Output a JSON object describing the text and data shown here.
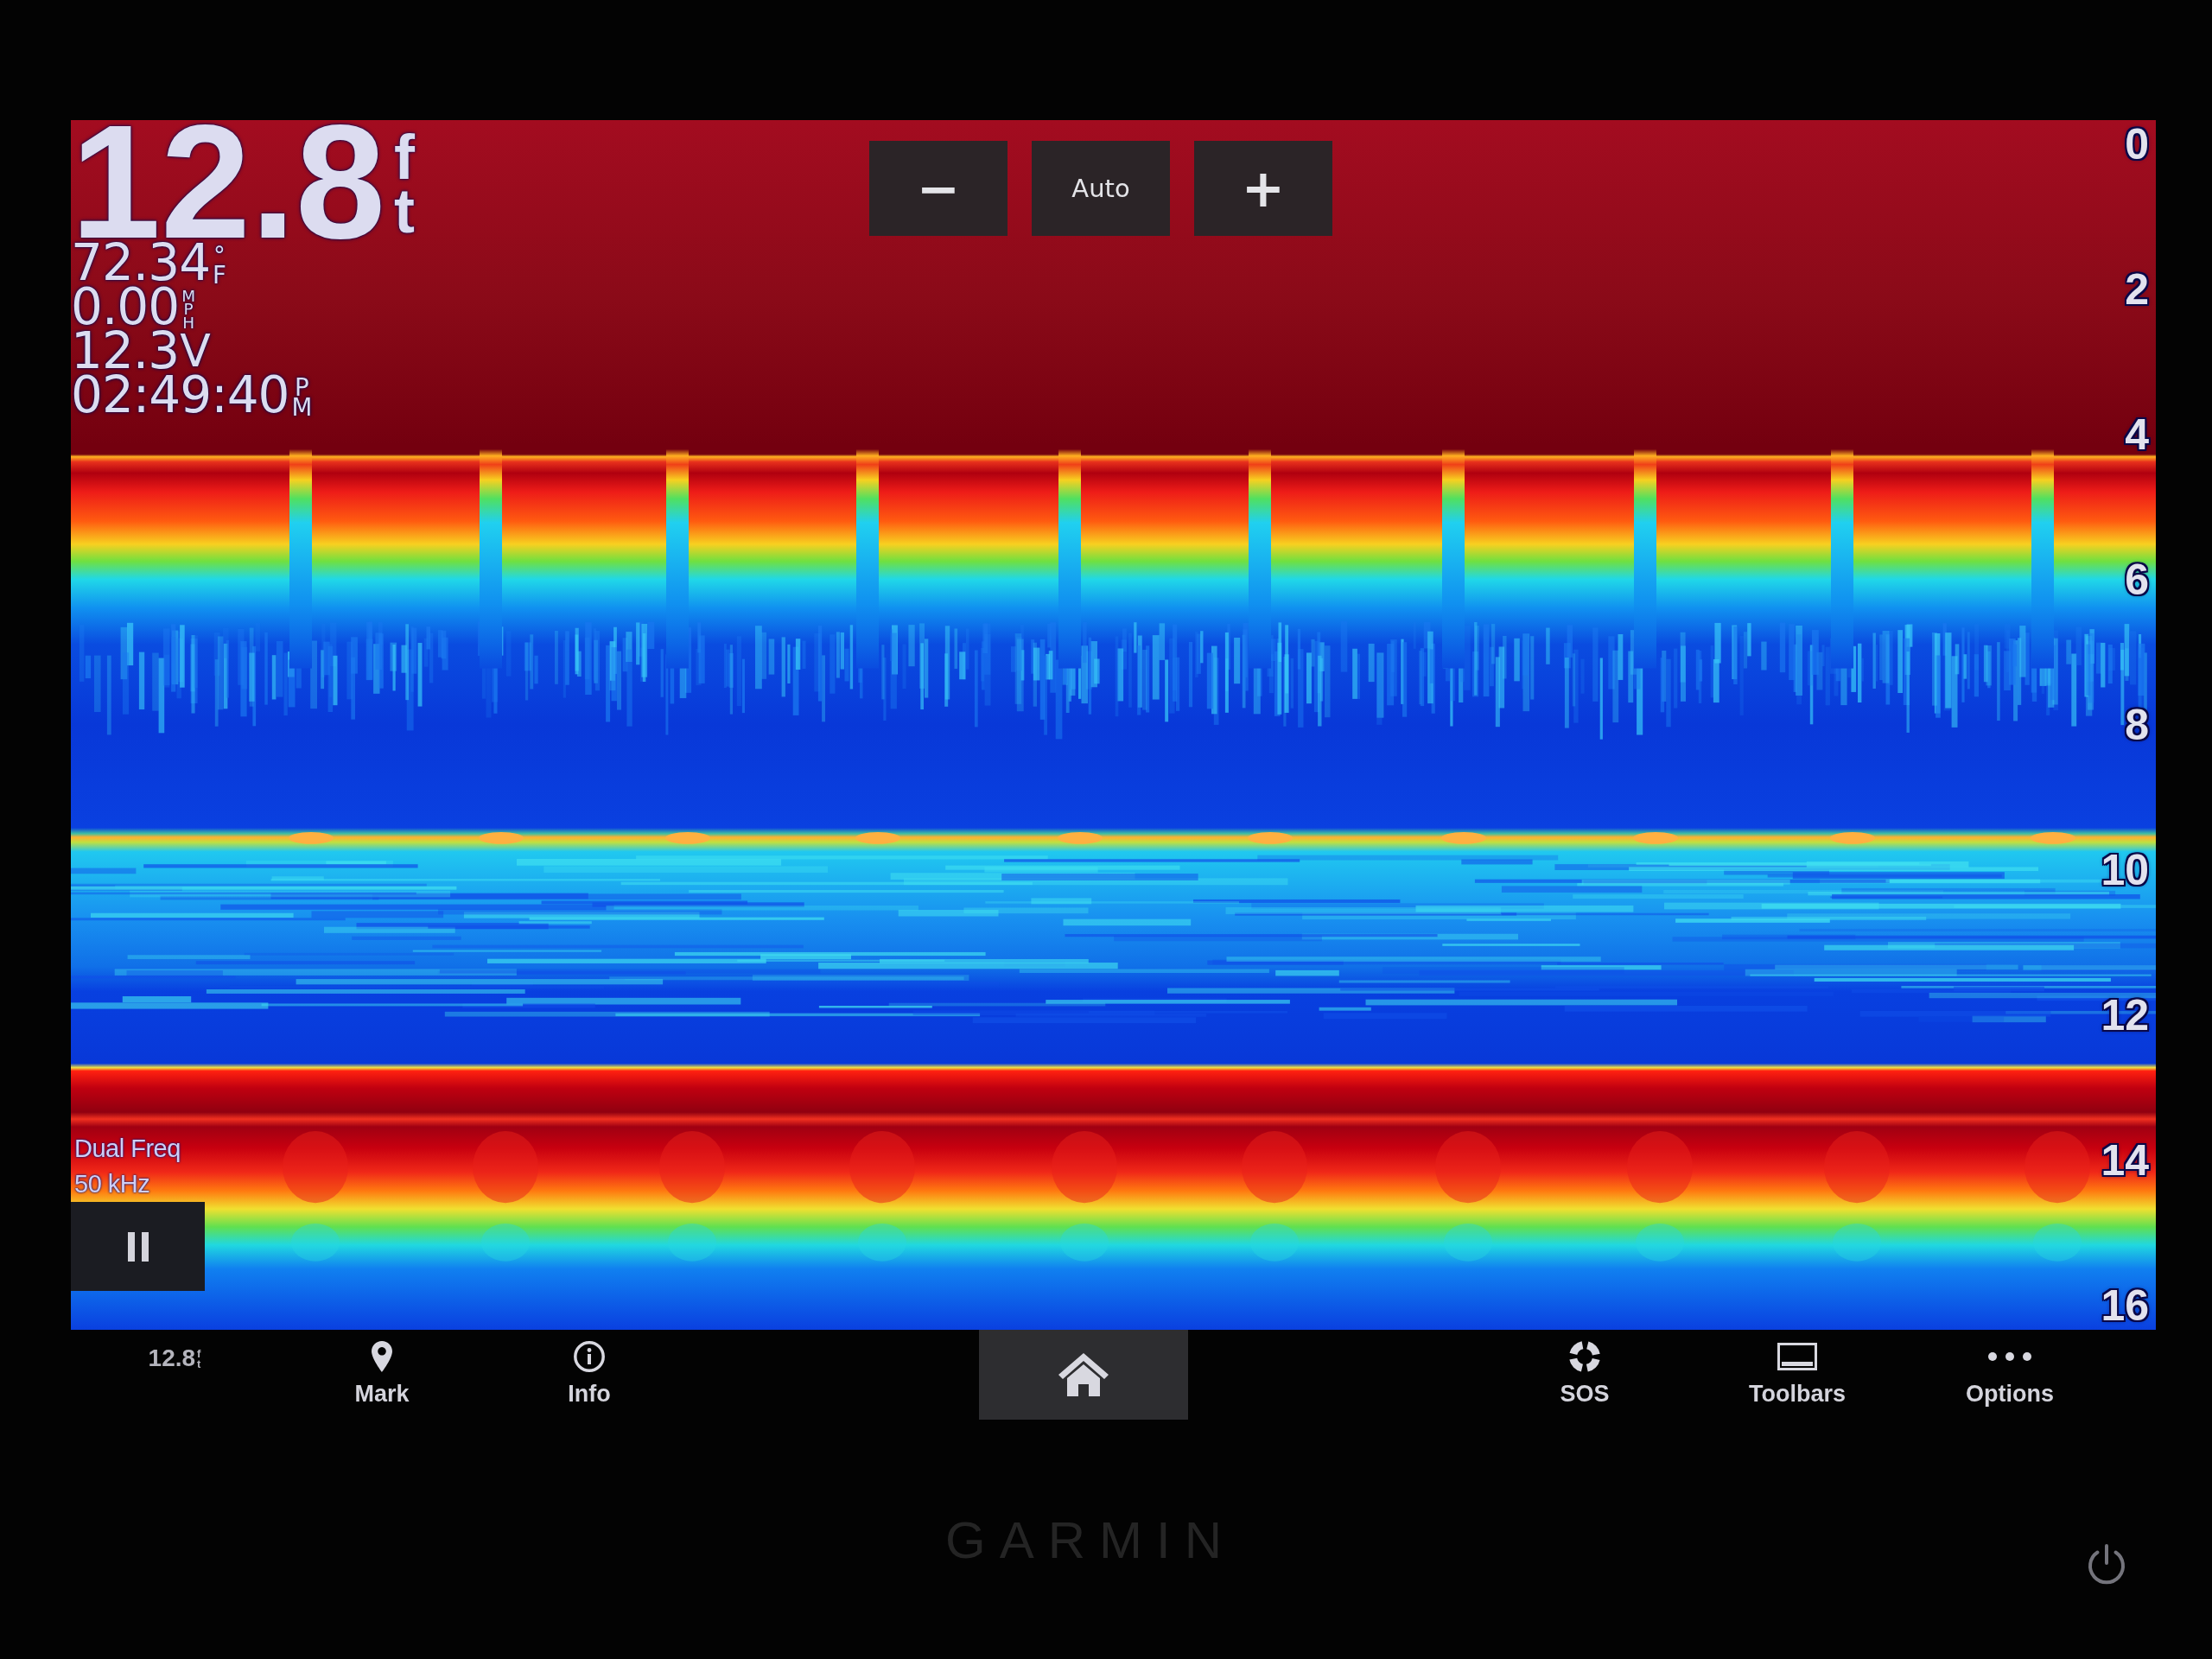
{
  "depth": {
    "value": "12.8",
    "unit": "ft"
  },
  "data_fields": [
    {
      "value": "72.34",
      "unit": "°F",
      "kind": "stacked"
    },
    {
      "value": "0.00",
      "unit": "MPH",
      "kind": "stacked"
    },
    {
      "value": "12.3",
      "unit": "V",
      "kind": "inline"
    },
    {
      "value": "02:49:40",
      "unit": "PM",
      "kind": "stacked"
    }
  ],
  "range_buttons": [
    {
      "label": "−",
      "kind": "symbol"
    },
    {
      "label": "Auto",
      "kind": "text"
    },
    {
      "label": "+",
      "kind": "symbol"
    }
  ],
  "depth_scale": [
    "0",
    "2",
    "4",
    "6",
    "8",
    "10",
    "12",
    "14",
    "16"
  ],
  "frequency": [
    "Dual Freq",
    "50 kHz"
  ],
  "toolbar": {
    "readout": {
      "value": "12.8",
      "unit": "ft"
    },
    "left_buttons": [
      {
        "label": "Mark"
      },
      {
        "label": "Info"
      }
    ],
    "right_buttons": [
      {
        "label": "SOS"
      },
      {
        "label": "Toolbars"
      },
      {
        "label": "Options"
      }
    ]
  },
  "bezel": {
    "logo": "GARMIN"
  }
}
